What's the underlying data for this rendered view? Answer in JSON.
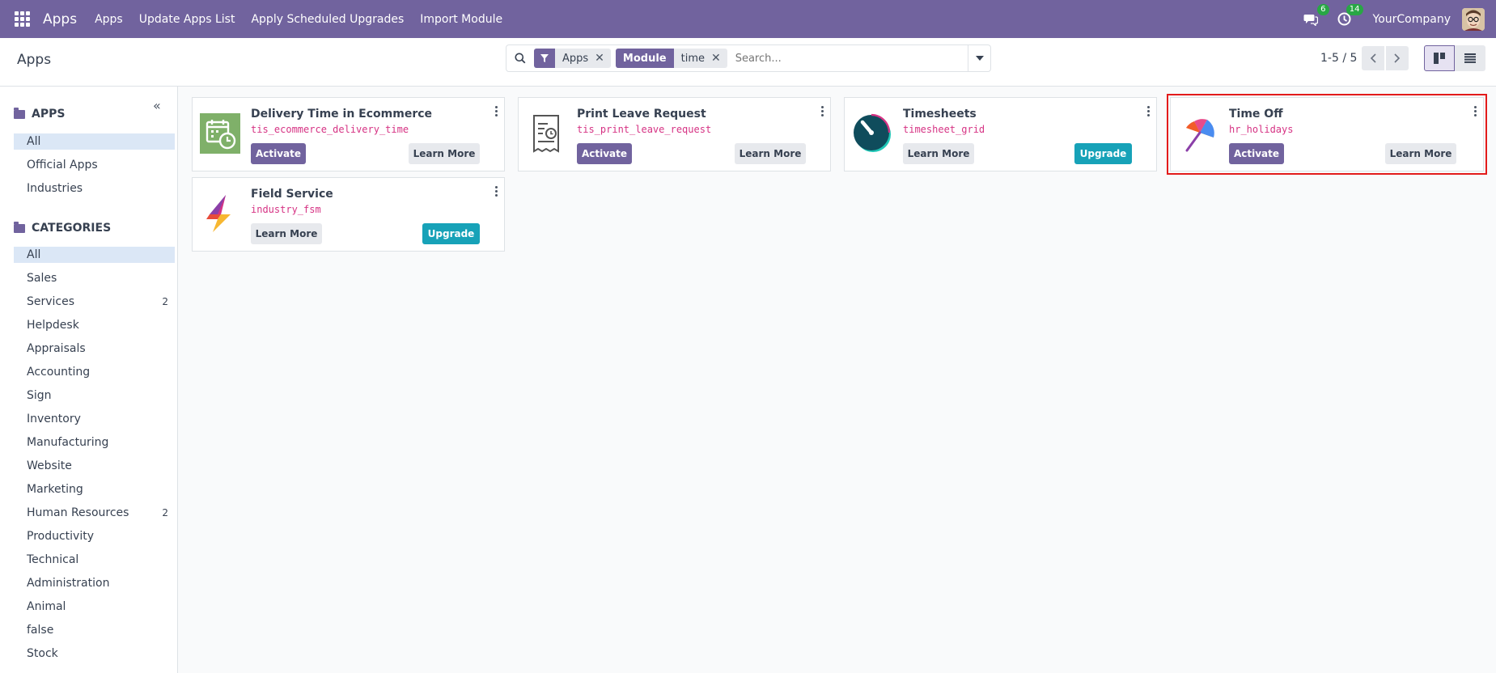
{
  "navbar": {
    "brand": "Apps",
    "menu": [
      "Apps",
      "Update Apps List",
      "Apply Scheduled Upgrades",
      "Import Module"
    ],
    "messages_count": "6",
    "activities_count": "14",
    "company": "YourCompany"
  },
  "control": {
    "breadcrumb": "Apps",
    "search": {
      "facets": [
        {
          "tag": "filter-icon",
          "value": "Apps"
        },
        {
          "tag": "Module",
          "value": "time"
        }
      ],
      "placeholder": "Search..."
    },
    "pager": "1-5 / 5"
  },
  "sidebar": {
    "apps_heading": "APPS",
    "apps_items": [
      {
        "label": "All",
        "active": true
      },
      {
        "label": "Official Apps"
      },
      {
        "label": "Industries"
      }
    ],
    "categories_heading": "CATEGORIES",
    "category_items": [
      {
        "label": "All",
        "active": true
      },
      {
        "label": "Sales"
      },
      {
        "label": "Services",
        "count": "2"
      },
      {
        "label": "Helpdesk"
      },
      {
        "label": "Appraisals"
      },
      {
        "label": "Accounting"
      },
      {
        "label": "Sign"
      },
      {
        "label": "Inventory"
      },
      {
        "label": "Manufacturing"
      },
      {
        "label": "Website"
      },
      {
        "label": "Marketing"
      },
      {
        "label": "Human Resources",
        "count": "2"
      },
      {
        "label": "Productivity"
      },
      {
        "label": "Technical"
      },
      {
        "label": "Administration"
      },
      {
        "label": "Animal"
      },
      {
        "label": "false"
      },
      {
        "label": "Stock"
      }
    ]
  },
  "cards": [
    {
      "title": "Delivery Time in Ecommerce",
      "tech": "tis_ecommerce_delivery_time",
      "left_button": "Activate",
      "right_button": "Learn More",
      "icon": "calendar-clock-icon"
    },
    {
      "title": "Print Leave Request",
      "tech": "tis_print_leave_request",
      "left_button": "Activate",
      "right_button": "Learn More",
      "icon": "receipt-icon"
    },
    {
      "title": "Timesheets",
      "tech": "timesheet_grid",
      "left_button": "Learn More",
      "right_button": "Upgrade",
      "icon": "timesheets-icon"
    },
    {
      "title": "Time Off",
      "tech": "hr_holidays",
      "left_button": "Activate",
      "right_button": "Learn More",
      "icon": "umbrella-icon"
    },
    {
      "title": "Field Service",
      "tech": "industry_fsm",
      "left_button": "Learn More",
      "right_button": "Upgrade",
      "icon": "lightning-icon"
    }
  ],
  "colors": {
    "navbar": "#71639e",
    "primary": "#71639e",
    "upgrade": "#17a2b8",
    "technical_name": "#d63384",
    "highlight": "#e31b1b"
  }
}
